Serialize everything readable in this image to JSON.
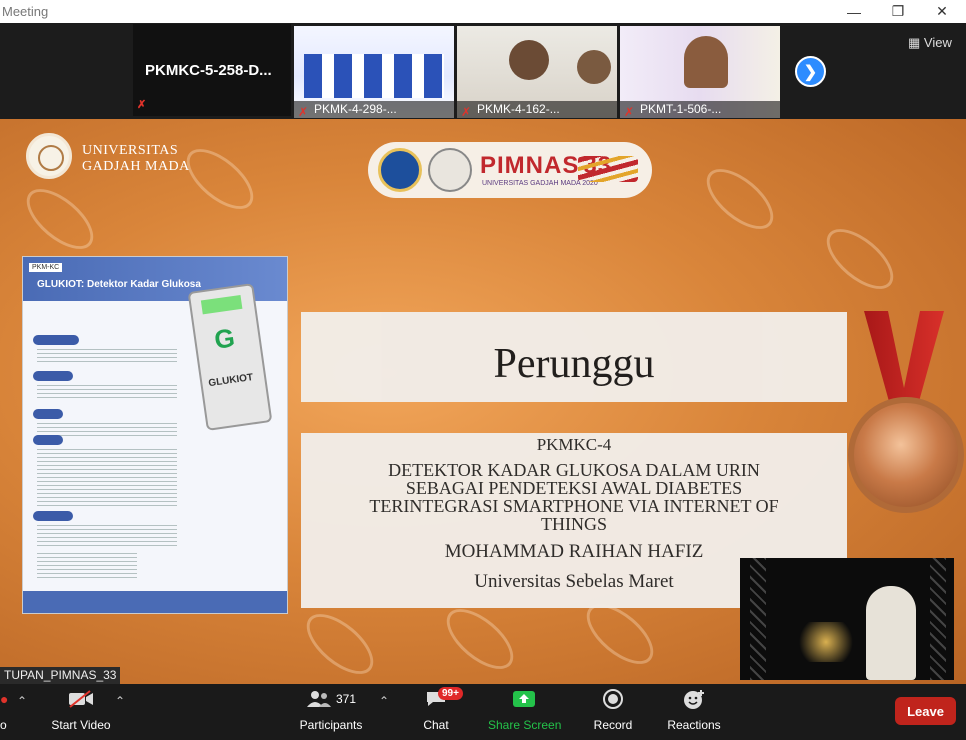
{
  "window": {
    "title": "Meeting",
    "minimize_icon": "minimize-icon",
    "maximize_icon": "restore-icon",
    "close_icon": "close-icon"
  },
  "participants_strip": {
    "active_speaker": "PKMKC-5-258-D...",
    "thumbnails": [
      {
        "label": "PKMK-4-298-..."
      },
      {
        "label": "PKMK-4-162-..."
      },
      {
        "label": "PKMT-1-506-..."
      }
    ],
    "view_label": "View"
  },
  "shared_screen": {
    "university_line1": "UNIVERSITAS",
    "university_line2": "GADJAH MADA",
    "event_name": "PIMNAS",
    "event_number": "33",
    "event_sub": "UNIVERSITAS GADJAH MADA 2020",
    "poster": {
      "tag": "PKM-KC",
      "title": "GLUKIOT: Detektor Kadar Glukosa",
      "device_text": "GLUKIOT"
    },
    "award": "Perunggu",
    "category": "PKMKC-4",
    "title_lines": [
      "DETEKTOR KADAR GLUKOSA DALAM URIN",
      "SEBAGAI PENDETEKSI AWAL DIABETES",
      "TERINTEGRASI SMARTPHONE VIA INTERNET OF",
      "THINGS"
    ],
    "name": "MOHAMMAD RAIHAN HAFIZ",
    "university": "Universitas Sebelas Maret"
  },
  "host_label": "TUPAN_PIMNAS_33",
  "toolbar": {
    "start_video": "Start Video",
    "participants": "Participants",
    "participants_count": "371",
    "chat": "Chat",
    "chat_badge": "99+",
    "share_screen": "Share Screen",
    "record": "Record",
    "reactions": "Reactions",
    "leave": "Leave",
    "audio_partial": "o"
  },
  "colors": {
    "accent_blue": "#2d8cff",
    "share_green": "#24c24a",
    "leave_red": "#c0241c",
    "mute_red": "#e0332b"
  }
}
